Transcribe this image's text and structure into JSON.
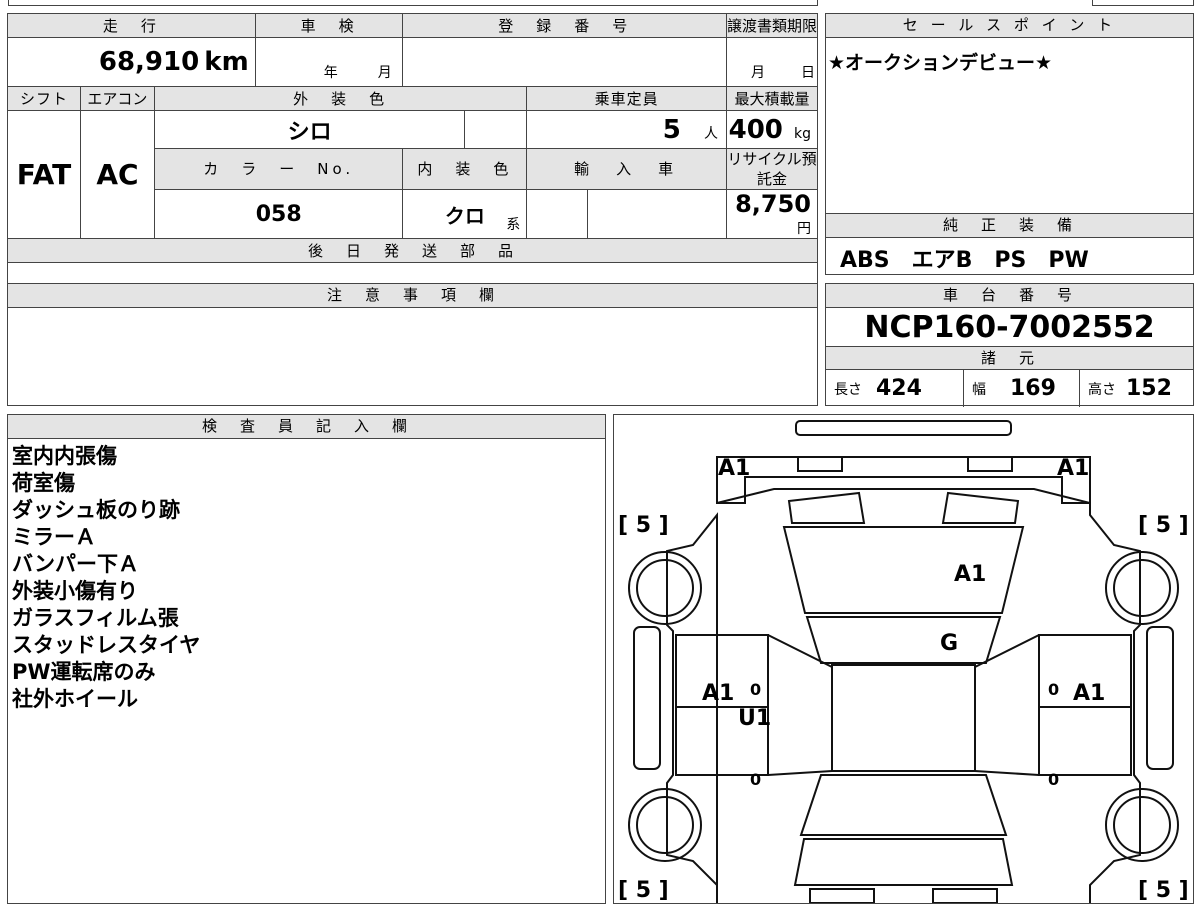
{
  "labels": {
    "mileage": "走　行",
    "inspection": "車　検",
    "registration": "登　録　番　号",
    "transfer_deadline": "譲渡書類期限",
    "sales_point": "セ ー ル ス ポ イ ン ト",
    "shift": "シフト",
    "aircon": "エアコン",
    "exterior_color": "外　装　色",
    "capacity": "乗車定員",
    "max_load": "最大積載量",
    "color_no": "カ　ラ　ー　No.",
    "interior_color": "内　装　色",
    "import": "輸　入　車",
    "recycle": "リサイクル預託金",
    "later_parts": "後　日　発　送　部　品",
    "factory_equipment": "純　正　装　備",
    "notes": "注　意　事　項　欄",
    "chassis": "車　台　番　号",
    "specs": "諸　元",
    "inspector": "検　査　員　記　入　欄",
    "year": "年",
    "month": "月",
    "day": "日",
    "person": "人",
    "kg": "kg",
    "yen": "円",
    "series": "系",
    "length": "長さ",
    "width": "幅",
    "height": "高さ"
  },
  "vehicle": {
    "mileage": "68,910",
    "mileage_unit": "km",
    "shift": "FAT",
    "aircon": "AC",
    "exterior_color": "シロ",
    "capacity": "5",
    "max_load": "400",
    "color_no": "058",
    "interior_color": "クロ",
    "recycle_fee": "8,750",
    "sales_point": "★オークションデビュー★",
    "equipment": "ABS　エアB　PS　PW",
    "chassis_number": "NCP160-7002552",
    "length": "424",
    "width": "169",
    "height": "152"
  },
  "inspector_notes": [
    "室内内張傷",
    "荷室傷",
    "ダッシュ板のり跡",
    "ミラーＡ",
    "バンパー下Ａ",
    "外装小傷有り",
    "ガラスフィルム張",
    "スタッドレスタイヤ",
    "PW運転席のみ",
    "社外ホイール"
  ],
  "diagram": {
    "tire_marks": [
      "[ 5 ]",
      "[ 5 ]",
      "[ 5 ]",
      "[ 5 ]"
    ],
    "labels": [
      "A1",
      "A1",
      "A1",
      "G",
      "A1",
      "U1",
      "A1",
      "0",
      "0",
      "0",
      "0"
    ]
  }
}
